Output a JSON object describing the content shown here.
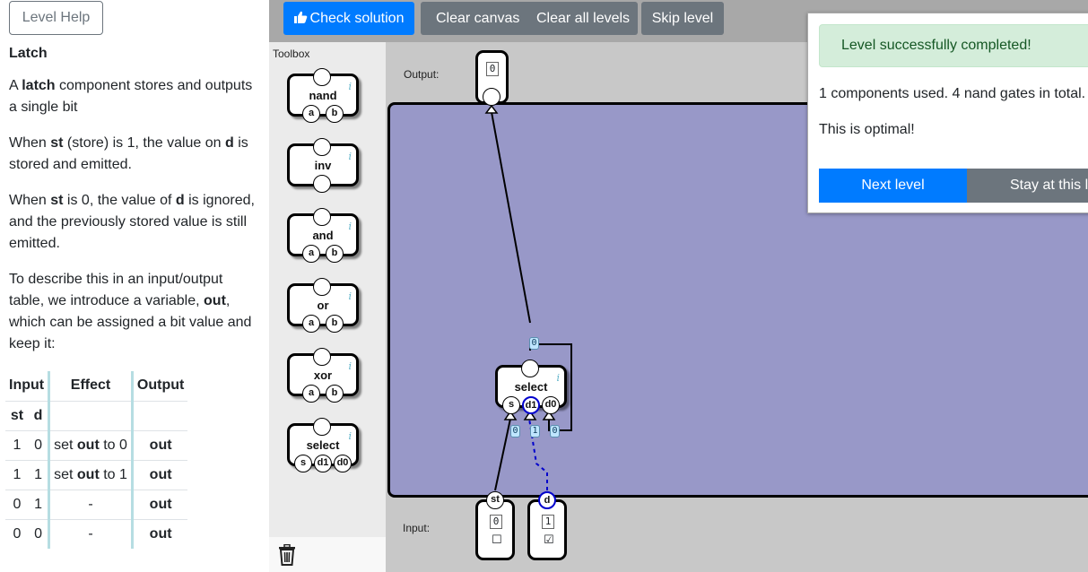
{
  "help": {
    "button_label": "Level Help",
    "title": "Latch",
    "p1_a": "A ",
    "p1_b": "latch",
    "p1_c": " component stores and outputs a single bit",
    "p2_a": "When ",
    "p2_b": "st",
    "p2_c": " (store) is 1, the value on ",
    "p2_d": "d",
    "p2_e": " is stored and emitted.",
    "p3_a": "When ",
    "p3_b": "st",
    "p3_c": " is 0, the value of ",
    "p3_d": "d",
    "p3_e": " is ignored, and the previously stored value is still emitted.",
    "p4_a": "To describe this in an input/output table, we introduce a variable, ",
    "p4_b": "out",
    "p4_c": ", which can be assigned a bit value and keep it:",
    "table": {
      "headers": [
        "Input",
        "Effect",
        "Output"
      ],
      "subheaders": [
        "st",
        "d"
      ],
      "rows": [
        {
          "st": "1",
          "d": "0",
          "effect_a": "set ",
          "effect_b": "out",
          "effect_c": " to 0",
          "output": "out"
        },
        {
          "st": "1",
          "d": "1",
          "effect_a": "set ",
          "effect_b": "out",
          "effect_c": " to 1",
          "output": "out"
        },
        {
          "st": "0",
          "d": "1",
          "effect_a": "-",
          "effect_b": "",
          "effect_c": "",
          "output": "out"
        },
        {
          "st": "0",
          "d": "0",
          "effect_a": "-",
          "effect_b": "",
          "effect_c": "",
          "output": "out"
        }
      ]
    }
  },
  "toolbar": {
    "check_label": "Check solution",
    "clear_canvas_label": "Clear canvas",
    "clear_all_label": "Clear all levels",
    "skip_label": "Skip level"
  },
  "toolbox": {
    "label": "Toolbox",
    "items": [
      {
        "name": "nand",
        "pins": [
          "a",
          "b"
        ]
      },
      {
        "name": "inv",
        "pins": []
      },
      {
        "name": "and",
        "pins": [
          "a",
          "b"
        ]
      },
      {
        "name": "or",
        "pins": [
          "a",
          "b"
        ]
      },
      {
        "name": "xor",
        "pins": [
          "a",
          "b"
        ]
      },
      {
        "name": "select",
        "pins": [
          "s",
          "d1",
          "d0"
        ]
      }
    ],
    "info_glyph": "i"
  },
  "canvas": {
    "output_label": "Output:",
    "input_label": "Input:",
    "output_value": "0",
    "select": {
      "name": "select",
      "pins": [
        "s",
        "d1",
        "d0"
      ],
      "out_tag": "0",
      "in_tags": [
        "0",
        "1",
        "0"
      ]
    },
    "inputs": [
      {
        "name": "st",
        "value": "0",
        "checked": "☐"
      },
      {
        "name": "d",
        "value": "1",
        "checked": "☑"
      }
    ]
  },
  "dialog": {
    "alert": "Level successfully completed!",
    "stats": "1 components used. 4 nand gates in total.",
    "optimal": "This is optimal!",
    "next_label": "Next level",
    "stay_label": "Stay at this level"
  },
  "colors": {
    "primary": "#007bff",
    "secondary": "#6c757d",
    "board": "#9898c8",
    "success_bg": "#d4edda",
    "success_text": "#155724"
  }
}
